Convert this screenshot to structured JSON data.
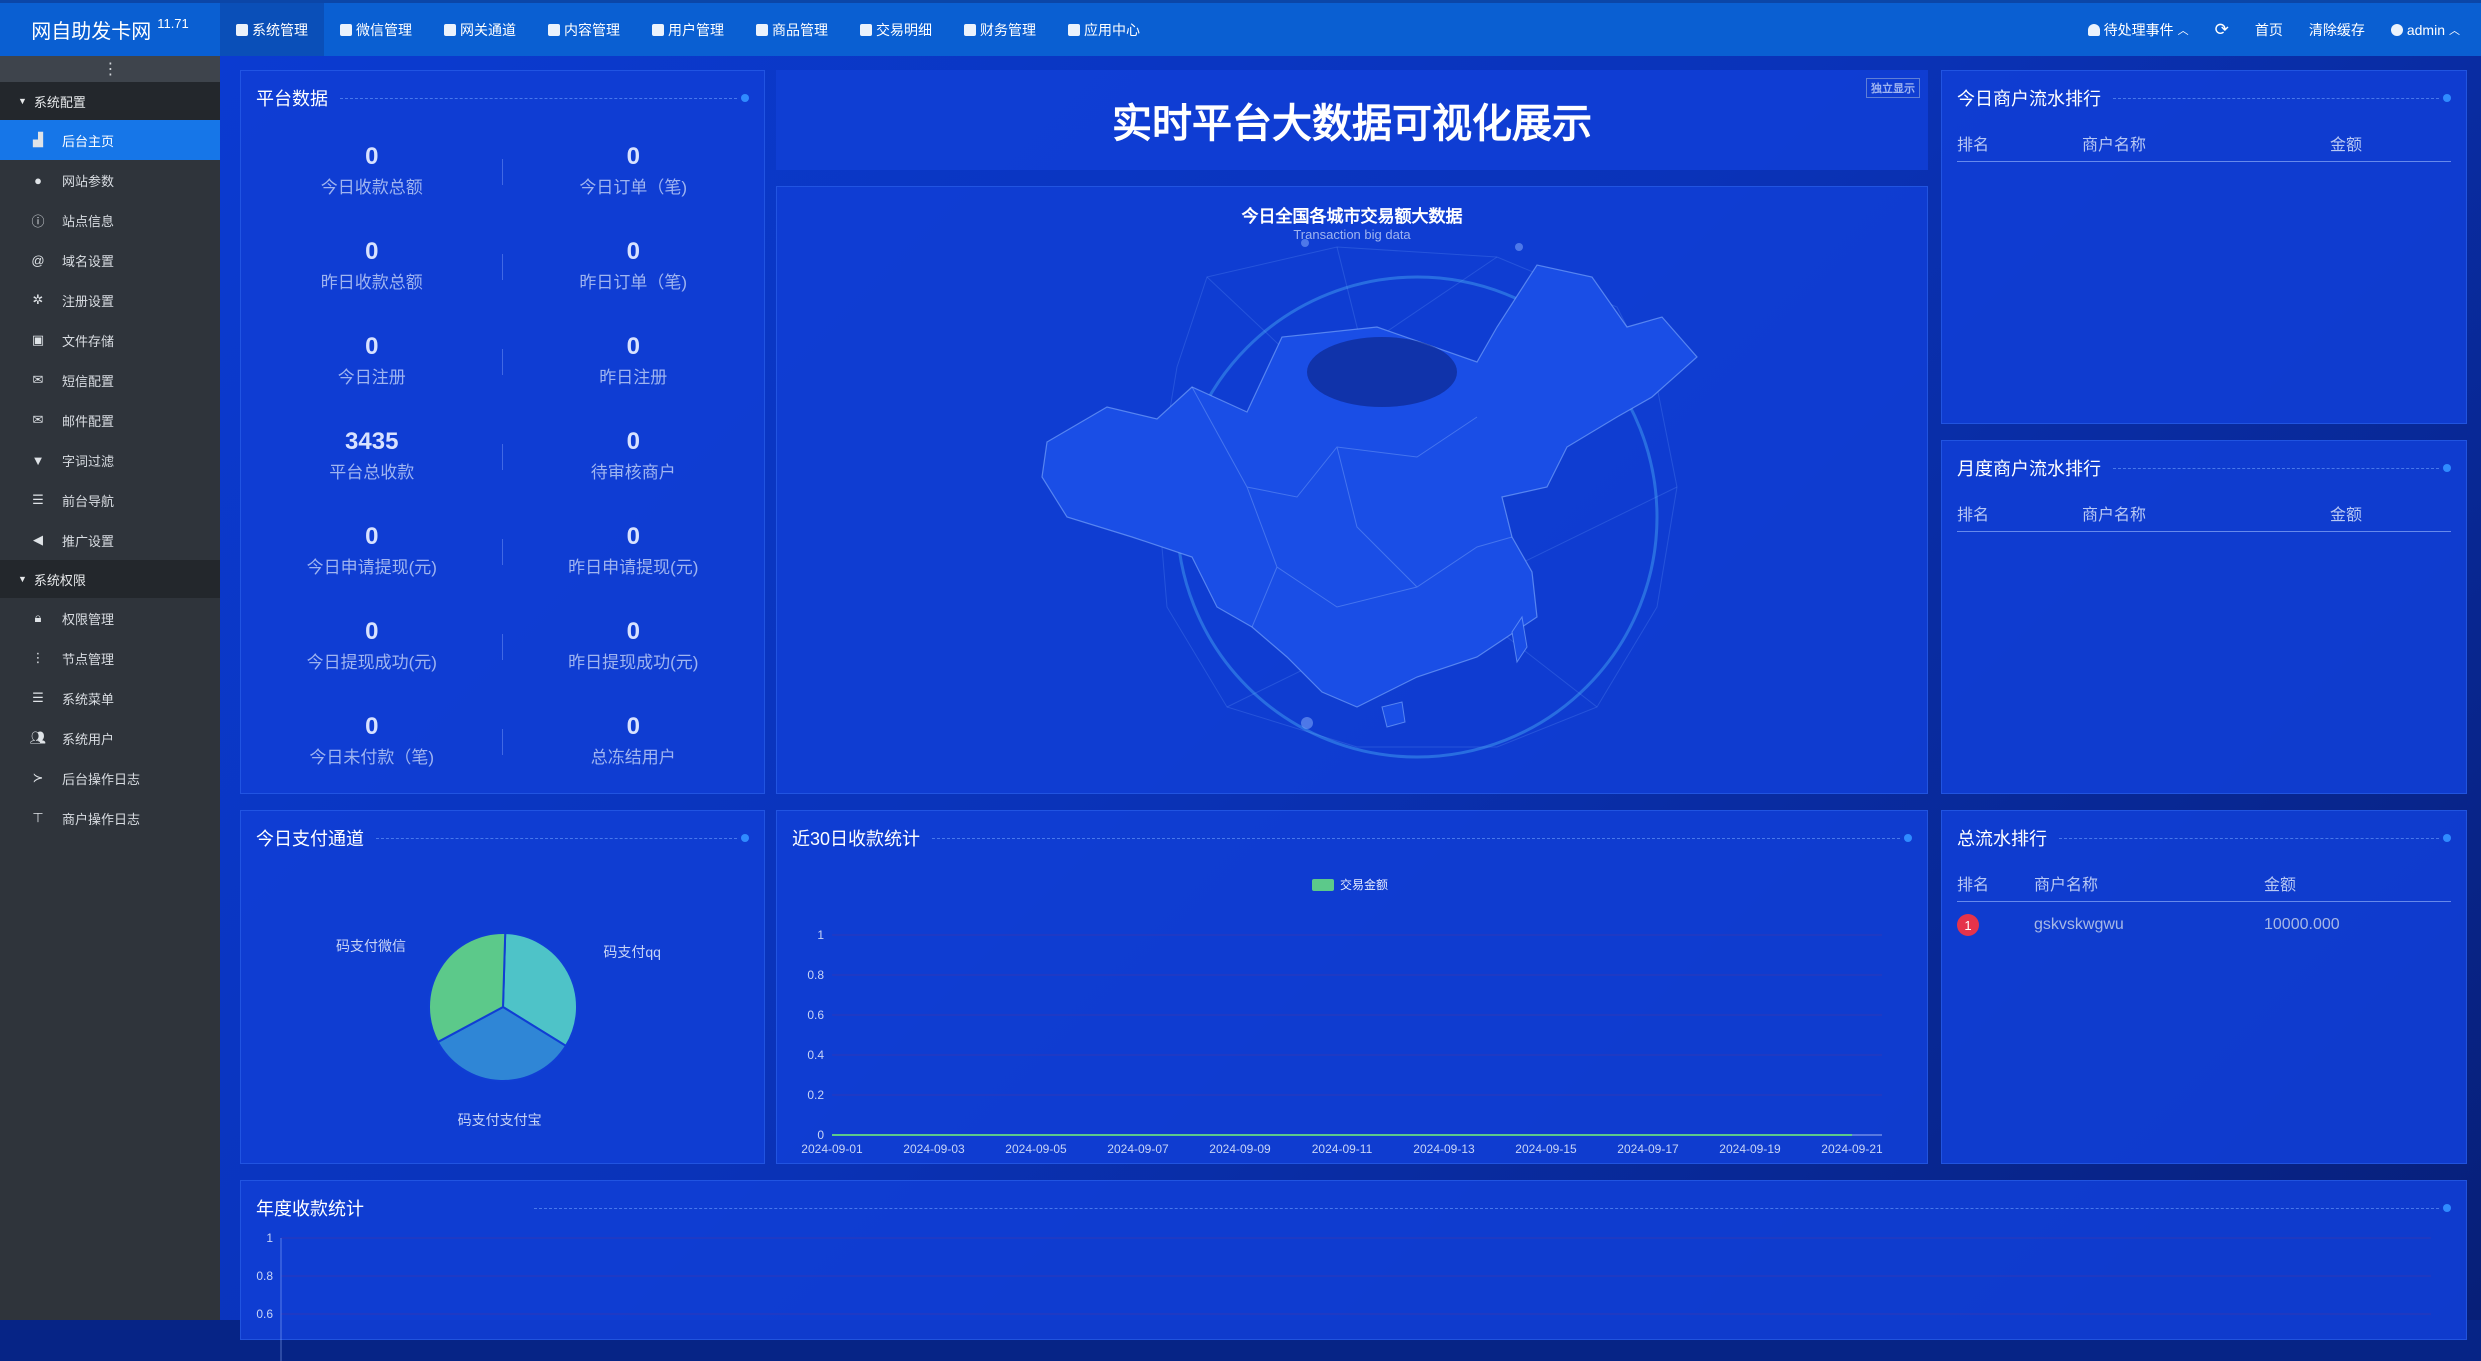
{
  "brand": {
    "name": "网自助发卡网",
    "version": "11.71"
  },
  "topnav": [
    {
      "label": "系统管理",
      "icon": "gear-icon",
      "active": true
    },
    {
      "label": "微信管理",
      "icon": "wechat-icon"
    },
    {
      "label": "网关通道",
      "icon": "gateway-icon"
    },
    {
      "label": "内容管理",
      "icon": "document-icon"
    },
    {
      "label": "用户管理",
      "icon": "users-icon"
    },
    {
      "label": "商品管理",
      "icon": "shop-icon"
    },
    {
      "label": "交易明细",
      "icon": "bar-chart-icon"
    },
    {
      "label": "财务管理",
      "icon": "finance-icon"
    },
    {
      "label": "应用中心",
      "icon": "cloud-icon"
    }
  ],
  "topright": {
    "pending": "待处理事件",
    "refresh_icon": "refresh-icon",
    "home": "首页",
    "clear_cache": "清除缓存",
    "user": "admin"
  },
  "sidebar": {
    "groups": [
      {
        "label": "系统配置",
        "items": [
          {
            "label": "后台主页",
            "icon": "area-chart-icon",
            "active": true
          },
          {
            "label": "网站参数",
            "icon": "apple-icon"
          },
          {
            "label": "站点信息",
            "icon": "info-icon"
          },
          {
            "label": "域名设置",
            "icon": "at-icon"
          },
          {
            "label": "注册设置",
            "icon": "gear-icon"
          },
          {
            "label": "文件存储",
            "icon": "save-icon"
          },
          {
            "label": "短信配置",
            "icon": "envelope-icon"
          },
          {
            "label": "邮件配置",
            "icon": "envelope-icon"
          },
          {
            "label": "字词过滤",
            "icon": "filter-icon"
          },
          {
            "label": "前台导航",
            "icon": "list-icon"
          },
          {
            "label": "推广设置",
            "icon": "bullhorn-icon"
          }
        ]
      },
      {
        "label": "系统权限",
        "items": [
          {
            "label": "权限管理",
            "icon": "lock-icon"
          },
          {
            "label": "节点管理",
            "icon": "ellipsis-icon"
          },
          {
            "label": "系统菜单",
            "icon": "list-icon"
          },
          {
            "label": "系统用户",
            "icon": "users-icon"
          },
          {
            "label": "后台操作日志",
            "icon": "terminal-icon"
          },
          {
            "label": "商户操作日志",
            "icon": "pin-icon"
          }
        ]
      }
    ]
  },
  "platform": {
    "title": "平台数据",
    "stats": [
      [
        {
          "value": "0",
          "label": "今日收款总额"
        },
        {
          "value": "0",
          "label": "今日订单（笔)"
        }
      ],
      [
        {
          "value": "0",
          "label": "昨日收款总额"
        },
        {
          "value": "0",
          "label": "昨日订单（笔)"
        }
      ],
      [
        {
          "value": "0",
          "label": "今日注册"
        },
        {
          "value": "0",
          "label": "昨日注册"
        }
      ],
      [
        {
          "value": "3435",
          "label": "平台总收款"
        },
        {
          "value": "0",
          "label": "待审核商户"
        }
      ],
      [
        {
          "value": "0",
          "label": "今日申请提现(元)"
        },
        {
          "value": "0",
          "label": "昨日申请提现(元)"
        }
      ],
      [
        {
          "value": "0",
          "label": "今日提现成功(元)"
        },
        {
          "value": "0",
          "label": "昨日提现成功(元)"
        }
      ],
      [
        {
          "value": "0",
          "label": "今日未付款（笔)"
        },
        {
          "value": "0",
          "label": "总冻结用户"
        }
      ]
    ]
  },
  "bigscreen": {
    "title": "实时平台大数据可视化展示",
    "solo_button": "独立显示"
  },
  "map": {
    "title": "今日全国各城市交易额大数据",
    "subtitle": "Transaction big data"
  },
  "today_rank": {
    "title": "今日商户流水排行",
    "headers": [
      "排名",
      "商户名称",
      "金额"
    ]
  },
  "month_rank": {
    "title": "月度商户流水排行",
    "headers": [
      "排名",
      "商户名称",
      "金额"
    ]
  },
  "total_rank": {
    "title": "总流水排行",
    "headers": [
      "排名",
      "商户名称",
      "金额"
    ],
    "rows": [
      {
        "rank": "1",
        "name": "gskvskwgwu",
        "amount": "10000.000"
      }
    ]
  },
  "pay_channel": {
    "title": "今日支付通道"
  },
  "recent30": {
    "title": "近30日收款统计"
  },
  "annual": {
    "title": "年度收款统计"
  },
  "colors": {
    "accent": "#1676e8",
    "topbar": "#0a5fd2",
    "panel": "#103ed4",
    "badge": "#e5334b"
  },
  "chart_data": [
    {
      "type": "pie",
      "labels": [
        "码支付qq",
        "码支付支付宝",
        "码支付微信"
      ],
      "values": [
        1,
        1,
        1
      ],
      "colors": [
        "#4ec3c8",
        "#2f86d6",
        "#5cc98a"
      ]
    },
    {
      "type": "line",
      "legend": [
        "交易金额"
      ],
      "x": [
        "2024-09-01",
        "2024-09-03",
        "2024-09-05",
        "2024-09-07",
        "2024-09-09",
        "2024-09-11",
        "2024-09-13",
        "2024-09-15",
        "2024-09-17",
        "2024-09-19",
        "2024-09-21"
      ],
      "yticks": [
        "0",
        "0.2",
        "0.4",
        "0.6",
        "0.8",
        "1"
      ],
      "ylim": [
        0,
        1
      ],
      "series": [
        {
          "name": "交易金额",
          "values": [
            0,
            0,
            0,
            0,
            0,
            0,
            0,
            0,
            0,
            0,
            0
          ]
        }
      ]
    },
    {
      "type": "line",
      "yticks": [
        "1",
        "0.8",
        "0.6"
      ],
      "ylim": [
        0,
        1
      ]
    }
  ]
}
